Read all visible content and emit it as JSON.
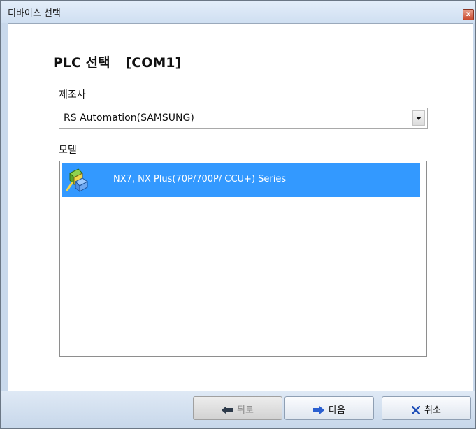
{
  "window": {
    "title": "디바이스 선택",
    "close_glyph": "x"
  },
  "heading": {
    "text": "PLC 선택",
    "port": "[COM1]"
  },
  "manufacturer": {
    "label": "제조사",
    "selected": "RS Automation(SAMSUNG)"
  },
  "model": {
    "label": "모델",
    "items": [
      {
        "text": "NX7, NX Plus(70P/700P/ CCU+) Series",
        "icon": "plc-device-icon",
        "selected": true
      }
    ]
  },
  "buttons": {
    "back": {
      "label": "뒤로",
      "icon": "left-arrow-icon",
      "enabled": false
    },
    "next": {
      "label": "다음",
      "icon": "right-arrow-icon",
      "enabled": true
    },
    "cancel": {
      "label": "취소",
      "icon": "x-icon",
      "enabled": true
    }
  },
  "colors": {
    "selection": "#3399ff",
    "frame": "#c9d9ec"
  }
}
